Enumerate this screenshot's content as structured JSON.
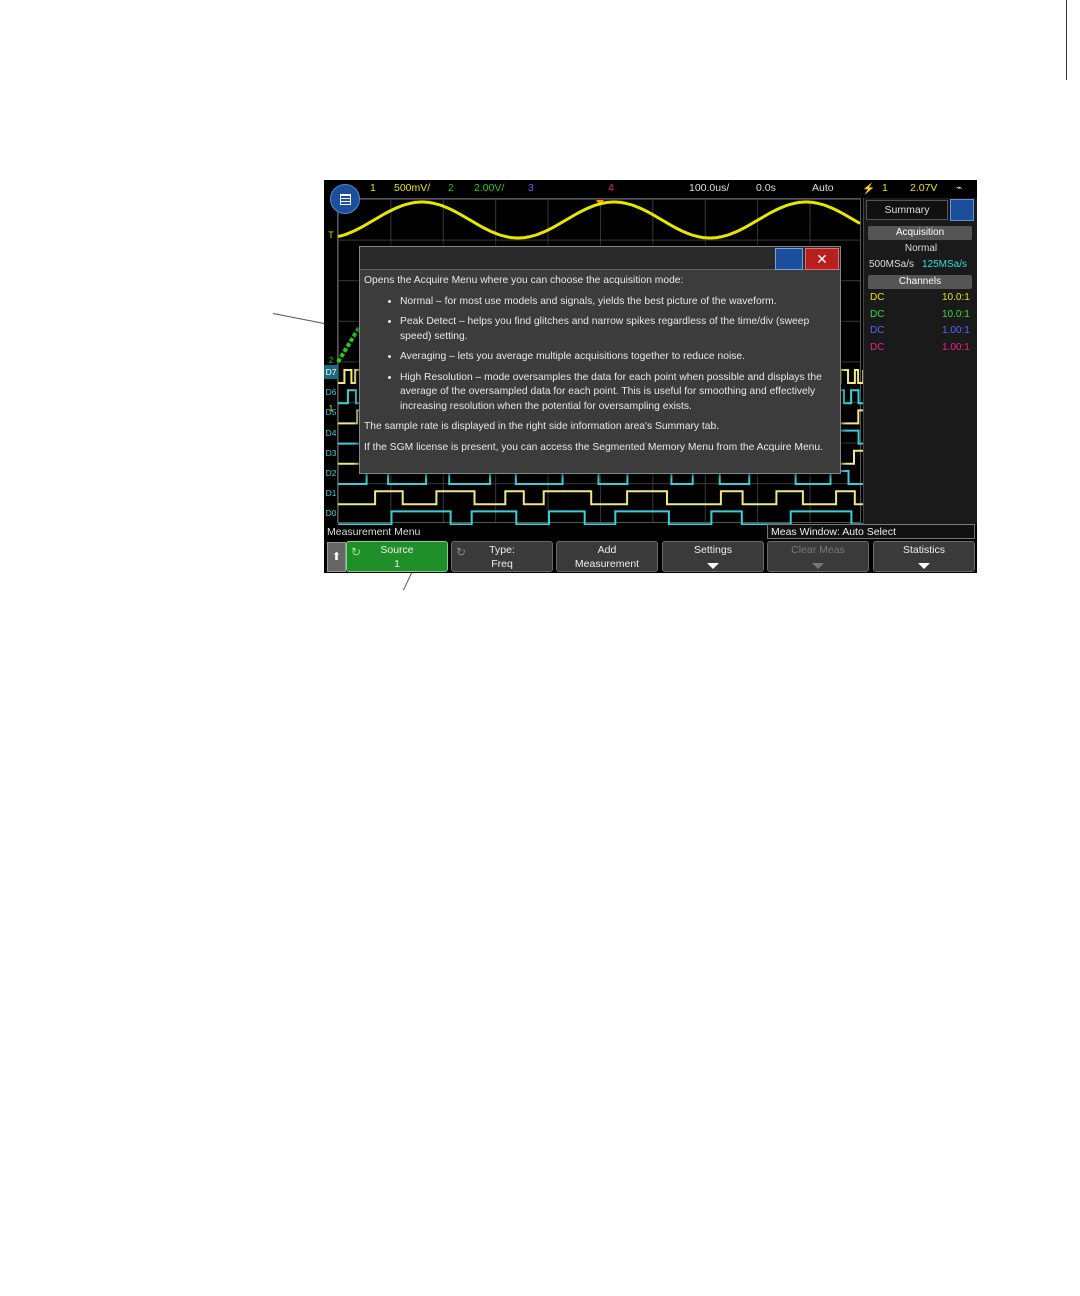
{
  "topbar": {
    "ch1_num": "1",
    "ch1_scale": "500mV/",
    "ch2_num": "2",
    "ch2_scale": "2.00V/",
    "ch3_num": "3",
    "ch4_num": "4",
    "timebase": "100.0us/",
    "delay": "0.0s",
    "trigger_mode": "Auto",
    "trigger_source": "1",
    "trigger_level": "2.07V"
  },
  "grid_labels": {
    "trigger_marker": "T",
    "digital_markers": [
      "2",
      "1"
    ],
    "digital_channels": [
      "D7",
      "D6",
      "D5",
      "D4",
      "D3",
      "D2",
      "D1",
      "D0"
    ]
  },
  "right_panel": {
    "tab_label": "Summary",
    "acquisition_header": "Acquisition",
    "acq_mode": "Normal",
    "sample_rate_a": "500MSa/s",
    "sample_rate_b": "125MSa/s",
    "channels_header": "Channels",
    "channels": [
      {
        "coupling": "DC",
        "probe": "10.0:1",
        "color": "#e6e600"
      },
      {
        "coupling": "DC",
        "probe": "10.0:1",
        "color": "#33dd33"
      },
      {
        "coupling": "DC",
        "probe": "1.00:1",
        "color": "#5566ff"
      },
      {
        "coupling": "DC",
        "probe": "1.00:1",
        "color": "#ee2288"
      }
    ]
  },
  "help": {
    "intro": "Opens the Acquire Menu where you can choose the acquisition mode:",
    "items": [
      "Normal – for most use models and signals, yields the best picture of the waveform.",
      "Peak Detect – helps you find glitches and narrow spikes regardless of the time/div (sweep speed) setting.",
      "Averaging – lets you average multiple acquisitions together to reduce noise.",
      "High Resolution – mode oversamples the data for each point when possible and displays the average of the oversampled data for each point. This is useful for smoothing and effectively increasing resolution when the potential for oversampling exists."
    ],
    "note1": "The sample rate is displayed in the right side information area's Summary tab.",
    "note2": "If the SGM license is present, you can access the Segmented Memory Menu from the Acquire Menu.",
    "close_glyph": "✕"
  },
  "softbar": {
    "title": "Measurement Menu",
    "meas_window": "Meas Window: Auto Select",
    "up_glyph": "⬆",
    "keys": [
      {
        "l1": "Source",
        "l2": "1"
      },
      {
        "l1": "Type:",
        "l2": "Freq"
      },
      {
        "l1": "Add",
        "l2": "Measurement"
      },
      {
        "l1": "Settings"
      },
      {
        "l1": "Clear Meas"
      },
      {
        "l1": "Statistics"
      }
    ]
  },
  "colors": {
    "ch1": "#e6e600",
    "ch2": "#22cc22",
    "ch3": "#5566ff",
    "ch4": "#ee2288",
    "digital": "#36d0d8",
    "bus": "#f0e880"
  }
}
